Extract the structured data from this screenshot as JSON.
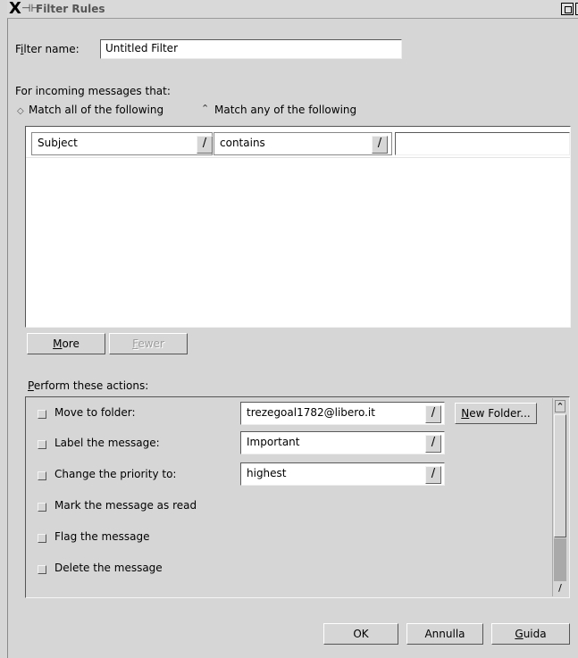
{
  "window": {
    "title": "Filter Rules",
    "logo": "X",
    "icon": "window-icon"
  },
  "filter_name": {
    "label_prefix": "F",
    "label_accel": "i",
    "label_rest": "lter name:",
    "value": "Untitled Filter"
  },
  "incoming": {
    "label": "For incoming messages that:",
    "match_all": "Match all of the following",
    "match_any": "Match any of the following",
    "selected": "match_any"
  },
  "condition": {
    "field": "Subject",
    "operator": "contains",
    "value": ""
  },
  "buttons": {
    "more_accel": "M",
    "more_rest": "ore",
    "fewer_accel": "F",
    "fewer_rest": "ewer",
    "new_folder_accel": "N",
    "new_folder_rest": "ew Folder...",
    "ok": "OK",
    "cancel": "Annulla",
    "help_accel": "G",
    "help_rest": "uida"
  },
  "actions": {
    "heading_accel": "P",
    "heading_rest": "erform these actions:",
    "move_label": "Move to folder:",
    "move_value": "trezegoal1782@libero.it",
    "label_label": "Label the message:",
    "label_value": "Important",
    "priority_label": "Change the priority to:",
    "priority_value": "highest",
    "mark_read_label": "Mark the message as read",
    "flag_label": "Flag the message",
    "delete_label": "Delete the message"
  },
  "colors": {
    "background": "#d6d6d6",
    "field_background": "#ffffff",
    "disabled_text": "#9c9c9c"
  }
}
